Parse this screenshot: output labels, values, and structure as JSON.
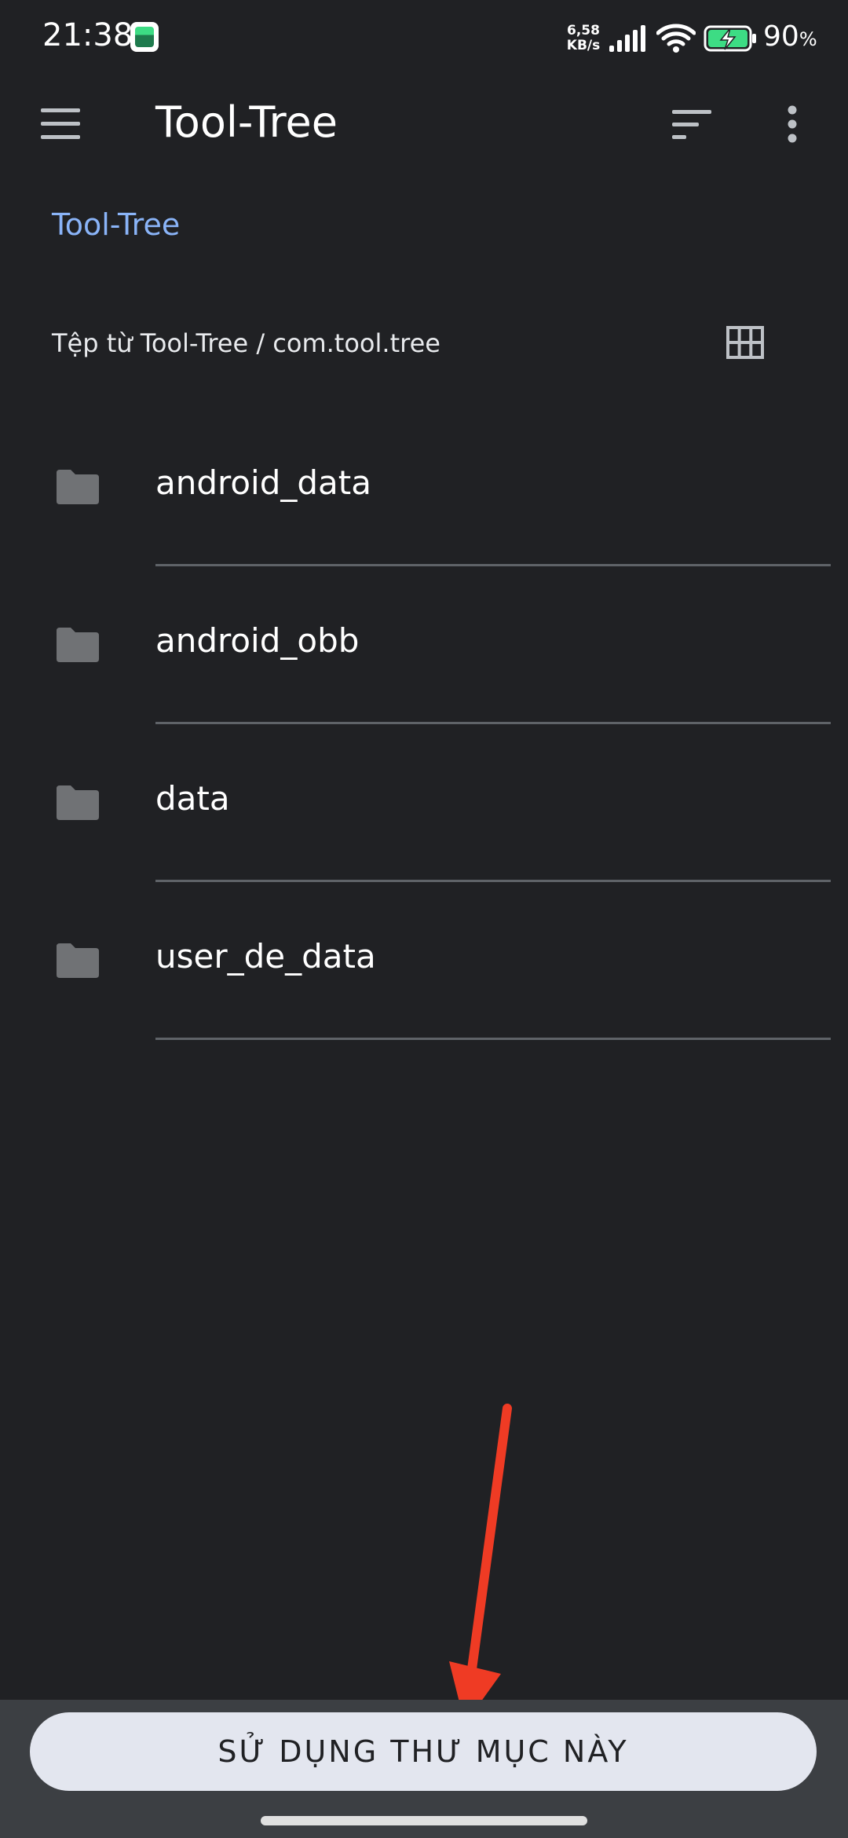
{
  "status_bar": {
    "time": "21:38",
    "net_speed_value": "6,58",
    "net_speed_unit": "KB/s",
    "battery_level": "90",
    "battery_unit": "%",
    "battery_color": "#3ddc84"
  },
  "app_bar": {
    "title": "Tool-Tree",
    "icons": [
      "menu-icon",
      "sort-icon",
      "more-vert-icon"
    ]
  },
  "breadcrumb": {
    "root": "Tool-Tree"
  },
  "source": {
    "label": "Tệp từ Tool-Tree / com.tool.tree",
    "view_toggle_icon": "grid-view-icon"
  },
  "folders": [
    {
      "name": "android_data",
      "icon": "folder-icon"
    },
    {
      "name": "android_obb",
      "icon": "folder-icon"
    },
    {
      "name": "data",
      "icon": "folder-icon"
    },
    {
      "name": "user_de_data",
      "icon": "folder-icon"
    }
  ],
  "bottom": {
    "button_label": "SỬ DỤNG THƯ MỤC NÀY"
  },
  "colors": {
    "background": "#202124",
    "accent_link": "#8ab4f8",
    "button_bg": "#e3e6ef",
    "annotation_arrow": "#ef3b24"
  }
}
